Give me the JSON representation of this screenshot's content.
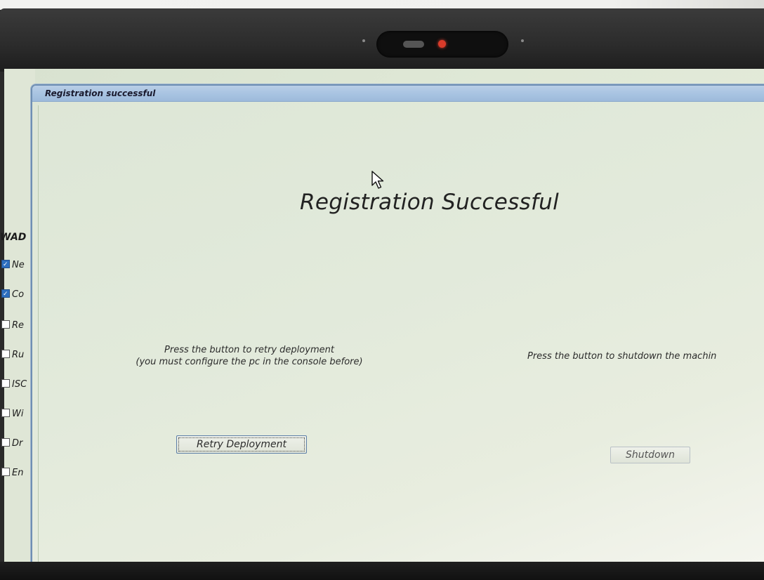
{
  "window": {
    "title": "Registration successful"
  },
  "main": {
    "heading": "Registration Successful",
    "retry_message_line1": "Press the button to retry deployment",
    "retry_message_line2": "(you must configure the pc in the console before)",
    "shutdown_message": "Press the button to shutdown the machin",
    "retry_button_label": "Retry Deployment",
    "shutdown_button_label": "Shutdown"
  },
  "background_window": {
    "heading": "WAD",
    "items": [
      {
        "label": "Ne",
        "checked": true
      },
      {
        "label": "Co",
        "checked": true
      },
      {
        "label": "Re",
        "checked": false
      },
      {
        "label": "Ru",
        "checked": false
      },
      {
        "label": "ISC",
        "checked": false
      },
      {
        "label": "Wi",
        "checked": false
      },
      {
        "label": "Dr",
        "checked": false
      },
      {
        "label": "En",
        "checked": false
      }
    ]
  },
  "colors": {
    "titlebar": "#a9c4e2",
    "window_border": "#6f8fb3",
    "webcam_led": "#d93b2a",
    "checkbox_checked": "#2d6fbf"
  },
  "icons": {
    "cursor": "arrow-cursor-icon",
    "webcam": "webcam-icon"
  }
}
